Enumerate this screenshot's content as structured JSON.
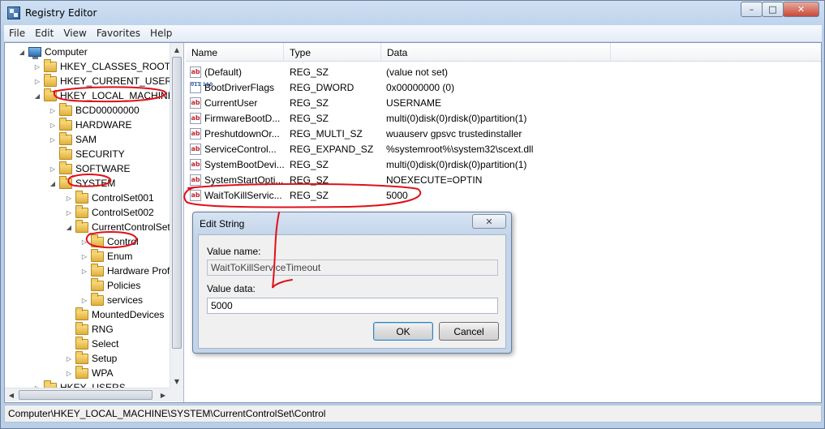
{
  "window": {
    "title": "Registry Editor",
    "minimize": "–",
    "maximize": "□",
    "close": "✕"
  },
  "menu": [
    "File",
    "Edit",
    "View",
    "Favorites",
    "Help"
  ],
  "tree": [
    {
      "label": "Computer",
      "arrow": "◢",
      "icon": "computer-icon",
      "level": 0
    },
    {
      "label": "HKEY_CLASSES_ROOT",
      "arrow": "▷",
      "icon": "folder-icon",
      "level": 1
    },
    {
      "label": "HKEY_CURRENT_USER",
      "arrow": "▷",
      "icon": "folder-icon",
      "level": 1
    },
    {
      "label": "HKEY_LOCAL_MACHINE",
      "arrow": "◢",
      "icon": "folder-icon",
      "level": 1
    },
    {
      "label": "BCD00000000",
      "arrow": "▷",
      "icon": "folder-icon",
      "level": 2
    },
    {
      "label": "HARDWARE",
      "arrow": "▷",
      "icon": "folder-icon",
      "level": 2
    },
    {
      "label": "SAM",
      "arrow": "▷",
      "icon": "folder-icon",
      "level": 2
    },
    {
      "label": "SECURITY",
      "arrow": "",
      "icon": "folder-icon",
      "level": 2
    },
    {
      "label": "SOFTWARE",
      "arrow": "▷",
      "icon": "folder-icon",
      "level": 2
    },
    {
      "label": "SYSTEM",
      "arrow": "◢",
      "icon": "folder-icon",
      "level": 2
    },
    {
      "label": "ControlSet001",
      "arrow": "▷",
      "icon": "folder-icon",
      "level": 3
    },
    {
      "label": "ControlSet002",
      "arrow": "▷",
      "icon": "folder-icon",
      "level": 3
    },
    {
      "label": "CurrentControlSet",
      "arrow": "◢",
      "icon": "folder-icon",
      "level": 3
    },
    {
      "label": "Control",
      "arrow": "▷",
      "icon": "folder-icon",
      "level": 4
    },
    {
      "label": "Enum",
      "arrow": "▷",
      "icon": "folder-icon",
      "level": 4
    },
    {
      "label": "Hardware Prof",
      "arrow": "▷",
      "icon": "folder-icon",
      "level": 4
    },
    {
      "label": "Policies",
      "arrow": "",
      "icon": "folder-icon",
      "level": 4
    },
    {
      "label": "services",
      "arrow": "▷",
      "icon": "folder-icon",
      "level": 4
    },
    {
      "label": "MountedDevices",
      "arrow": "",
      "icon": "folder-icon",
      "level": 3
    },
    {
      "label": "RNG",
      "arrow": "",
      "icon": "folder-icon",
      "level": 3
    },
    {
      "label": "Select",
      "arrow": "",
      "icon": "folder-icon",
      "level": 3
    },
    {
      "label": "Setup",
      "arrow": "▷",
      "icon": "folder-icon",
      "level": 3
    },
    {
      "label": "WPA",
      "arrow": "▷",
      "icon": "folder-icon",
      "level": 3
    },
    {
      "label": "HKEY_USERS",
      "arrow": "▷",
      "icon": "folder-icon",
      "level": 1
    }
  ],
  "list": {
    "columns": [
      "Name",
      "Type",
      "Data"
    ],
    "rows": [
      {
        "icon": "string-value-icon",
        "name": "(Default)",
        "type": "REG_SZ",
        "data": "(value not set)"
      },
      {
        "icon": "binary-value-icon",
        "name": "BootDriverFlags",
        "type": "REG_DWORD",
        "data": "0x00000000 (0)"
      },
      {
        "icon": "string-value-icon",
        "name": "CurrentUser",
        "type": "REG_SZ",
        "data": "USERNAME"
      },
      {
        "icon": "string-value-icon",
        "name": "FirmwareBootD...",
        "type": "REG_SZ",
        "data": "multi(0)disk(0)rdisk(0)partition(1)"
      },
      {
        "icon": "string-value-icon",
        "name": "PreshutdownOr...",
        "type": "REG_MULTI_SZ",
        "data": "wuauserv gpsvc trustedinstaller"
      },
      {
        "icon": "string-value-icon",
        "name": "ServiceControl...",
        "type": "REG_EXPAND_SZ",
        "data": "%systemroot%\\system32\\scext.dll"
      },
      {
        "icon": "string-value-icon",
        "name": "SystemBootDevi...",
        "type": "REG_SZ",
        "data": "multi(0)disk(0)rdisk(0)partition(1)"
      },
      {
        "icon": "string-value-icon",
        "name": "SystemStartOpti...",
        "type": "REG_SZ",
        "data": " NOEXECUTE=OPTIN"
      },
      {
        "icon": "string-value-icon",
        "name": "WaitToKillServic...",
        "type": "REG_SZ",
        "data": "5000"
      }
    ]
  },
  "dialog": {
    "title": "Edit String",
    "close": "✕",
    "value_name_label": "Value name:",
    "value_name": "WaitToKillServiceTimeout",
    "value_data_label": "Value data:",
    "value_data": "5000",
    "ok": "OK",
    "cancel": "Cancel"
  },
  "status": "Computer\\HKEY_LOCAL_MACHINE\\SYSTEM\\CurrentControlSet\\Control",
  "colors": {
    "annotation": "#e0101a",
    "title_bar": "#c3d5ea"
  }
}
